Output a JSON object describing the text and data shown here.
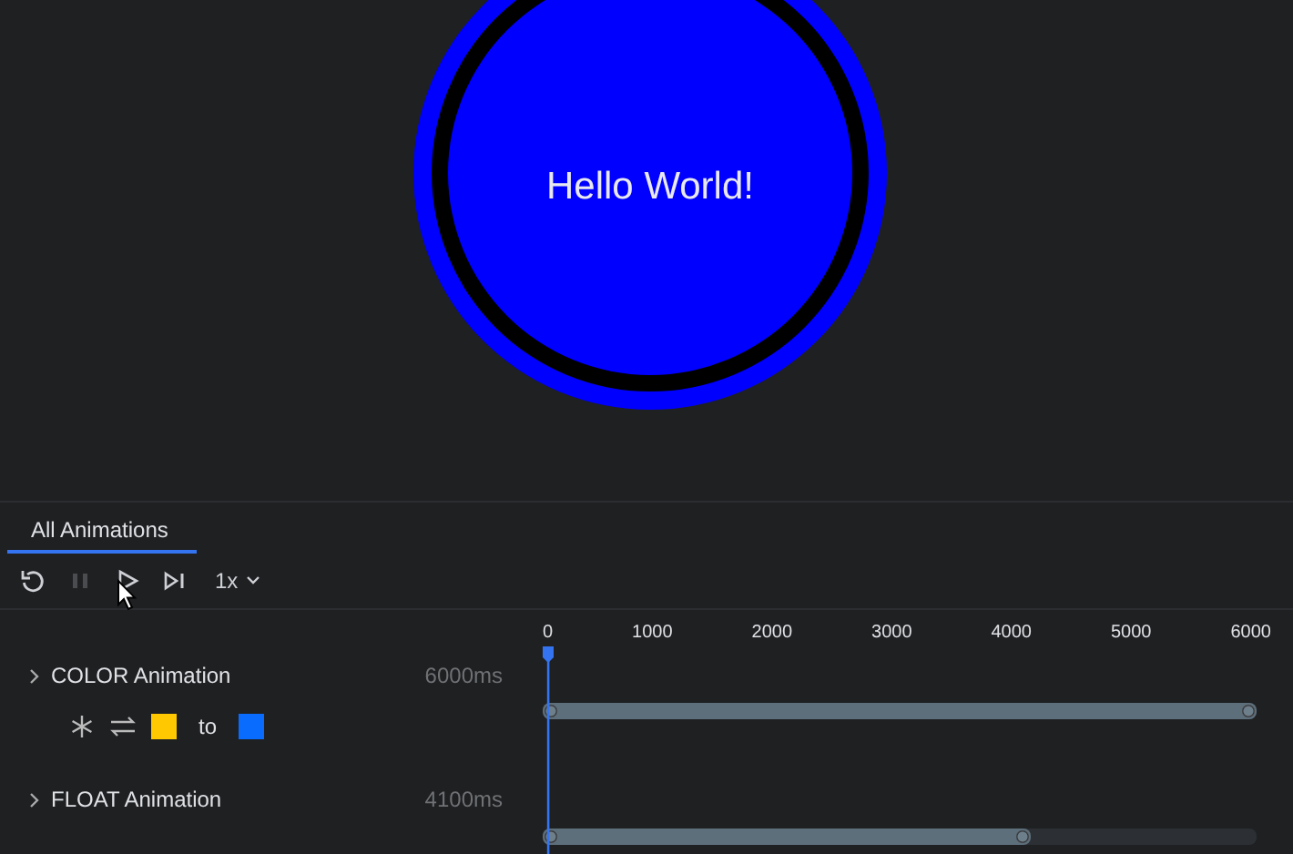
{
  "preview": {
    "text": "Hello World!"
  },
  "tabs": [
    {
      "label": "All Animations",
      "selected": true
    }
  ],
  "toolbar": {
    "buttons": [
      {
        "kind": "replay",
        "disabled": false
      },
      {
        "kind": "pause",
        "disabled": true
      },
      {
        "kind": "play",
        "disabled": false
      },
      {
        "kind": "step",
        "disabled": false
      }
    ],
    "speed": "1x"
  },
  "ruler": [
    "0",
    "1000",
    "2000",
    "3000",
    "4000",
    "5000",
    "6000"
  ],
  "animations": [
    {
      "name": "COLOR Animation",
      "duration": "6000ms",
      "level": 1,
      "swatches": [
        {
          "color": "#ffc800"
        },
        {
          "color": "#0a6cff"
        }
      ],
      "separator": "to"
    },
    {
      "name": "FLOAT Animation",
      "duration": "4100ms",
      "level": 0.683
    }
  ]
}
